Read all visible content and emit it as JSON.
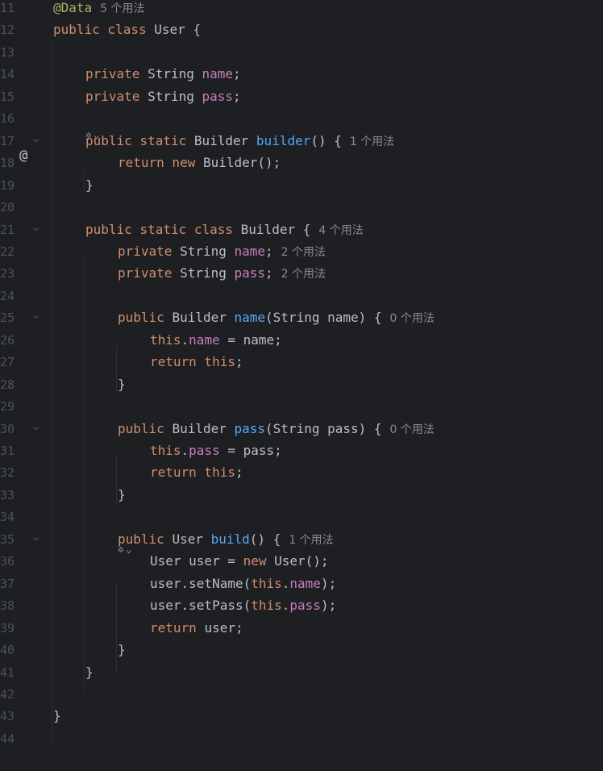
{
  "editor": {
    "lines": [
      {
        "n": "11",
        "tokens": [
          [
            "ann",
            "@Data"
          ]
        ],
        "hint": "5 个用法"
      },
      {
        "n": "12",
        "tokens": [
          [
            "kw",
            "public class "
          ],
          [
            "t",
            "User {"
          ]
        ]
      },
      {
        "n": "13",
        "tokens": []
      },
      {
        "n": "14",
        "tokens": [
          [
            "kw",
            "private "
          ],
          [
            "t",
            "String "
          ],
          [
            "fld",
            "name"
          ],
          [
            "t",
            ";"
          ]
        ]
      },
      {
        "n": "15",
        "tokens": [
          [
            "kw",
            "private "
          ],
          [
            "t",
            "String "
          ],
          [
            "fld",
            "pass"
          ],
          [
            "t",
            ";"
          ]
        ]
      },
      {
        "n": "16",
        "tokens": []
      },
      {
        "n": "17",
        "tokens": [
          [
            "kw",
            "public static "
          ],
          [
            "t",
            "Builder "
          ],
          [
            "fn",
            "builder"
          ],
          [
            "t",
            "() {"
          ]
        ],
        "hint": "1 个用法"
      },
      {
        "n": "18",
        "tokens": [
          [
            "kw",
            "return new "
          ],
          [
            "t",
            "Builder();"
          ]
        ]
      },
      {
        "n": "19",
        "tokens": [
          [
            "t",
            "}"
          ]
        ]
      },
      {
        "n": "20",
        "tokens": []
      },
      {
        "n": "21",
        "tokens": [
          [
            "kw",
            "public static class "
          ],
          [
            "t",
            "Builder {"
          ]
        ],
        "hint": "4 个用法"
      },
      {
        "n": "22",
        "tokens": [
          [
            "kw",
            "private "
          ],
          [
            "t",
            "String "
          ],
          [
            "fld",
            "name"
          ],
          [
            "t",
            ";"
          ]
        ],
        "hint": "2 个用法"
      },
      {
        "n": "23",
        "tokens": [
          [
            "kw",
            "private "
          ],
          [
            "t",
            "String "
          ],
          [
            "fld",
            "pass"
          ],
          [
            "t",
            ";"
          ]
        ],
        "hint": "2 个用法"
      },
      {
        "n": "24",
        "tokens": []
      },
      {
        "n": "25",
        "tokens": [
          [
            "kw",
            "public "
          ],
          [
            "t",
            "Builder "
          ],
          [
            "fn",
            "name"
          ],
          [
            "t",
            "(String name) {"
          ]
        ],
        "hint": "0 个用法"
      },
      {
        "n": "26",
        "tokens": [
          [
            "kw",
            "this"
          ],
          [
            "t",
            "."
          ],
          [
            "fld",
            "name"
          ],
          [
            "t",
            " = name;"
          ]
        ]
      },
      {
        "n": "27",
        "tokens": [
          [
            "kw",
            "return this"
          ],
          [
            "t",
            ";"
          ]
        ]
      },
      {
        "n": "28",
        "tokens": [
          [
            "t",
            "}"
          ]
        ]
      },
      {
        "n": "29",
        "tokens": []
      },
      {
        "n": "30",
        "tokens": [
          [
            "kw",
            "public "
          ],
          [
            "t",
            "Builder "
          ],
          [
            "fn",
            "pass"
          ],
          [
            "t",
            "(String pass) {"
          ]
        ],
        "hint": "0 个用法"
      },
      {
        "n": "31",
        "tokens": [
          [
            "kw",
            "this"
          ],
          [
            "t",
            "."
          ],
          [
            "fld",
            "pass"
          ],
          [
            "t",
            " = pass;"
          ]
        ]
      },
      {
        "n": "32",
        "tokens": [
          [
            "kw",
            "return this"
          ],
          [
            "t",
            ";"
          ]
        ]
      },
      {
        "n": "33",
        "tokens": [
          [
            "t",
            "}"
          ]
        ]
      },
      {
        "n": "34",
        "tokens": []
      },
      {
        "n": "35",
        "tokens": [
          [
            "kw",
            "public "
          ],
          [
            "t",
            "User "
          ],
          [
            "fn",
            "build"
          ],
          [
            "t",
            "() {"
          ]
        ],
        "hint": "1 个用法"
      },
      {
        "n": "36",
        "tokens": [
          [
            "t",
            "User user = "
          ],
          [
            "kw",
            "new "
          ],
          [
            "t",
            "User();"
          ]
        ]
      },
      {
        "n": "37",
        "tokens": [
          [
            "t",
            "user.setName("
          ],
          [
            "kw",
            "this"
          ],
          [
            "t",
            "."
          ],
          [
            "fld",
            "name"
          ],
          [
            "t",
            ");"
          ]
        ]
      },
      {
        "n": "38",
        "tokens": [
          [
            "t",
            "user.setPass("
          ],
          [
            "kw",
            "this"
          ],
          [
            "t",
            "."
          ],
          [
            "fld",
            "pass"
          ],
          [
            "t",
            ");"
          ]
        ]
      },
      {
        "n": "39",
        "tokens": [
          [
            "kw",
            "return "
          ],
          [
            "t",
            "user;"
          ]
        ]
      },
      {
        "n": "40",
        "tokens": [
          [
            "t",
            "}"
          ]
        ]
      },
      {
        "n": "41",
        "tokens": [
          [
            "t",
            "}"
          ]
        ]
      },
      {
        "n": "42",
        "tokens": []
      },
      {
        "n": "43",
        "tokens": [
          [
            "t",
            "}"
          ]
        ]
      },
      {
        "n": "44",
        "tokens": []
      }
    ],
    "gutter_at_symbol": "@",
    "ai_icons": [
      "ai-assist-icon",
      "ai-assist-icon"
    ],
    "colors": {
      "background": "#1e1f22",
      "keyword": "#cf8e6d",
      "field": "#c77dbb",
      "method": "#56a8f5",
      "annotation": "#b3ae60",
      "text": "#bcbec4",
      "hint": "#868a91",
      "line_number": "#4b5059"
    }
  }
}
